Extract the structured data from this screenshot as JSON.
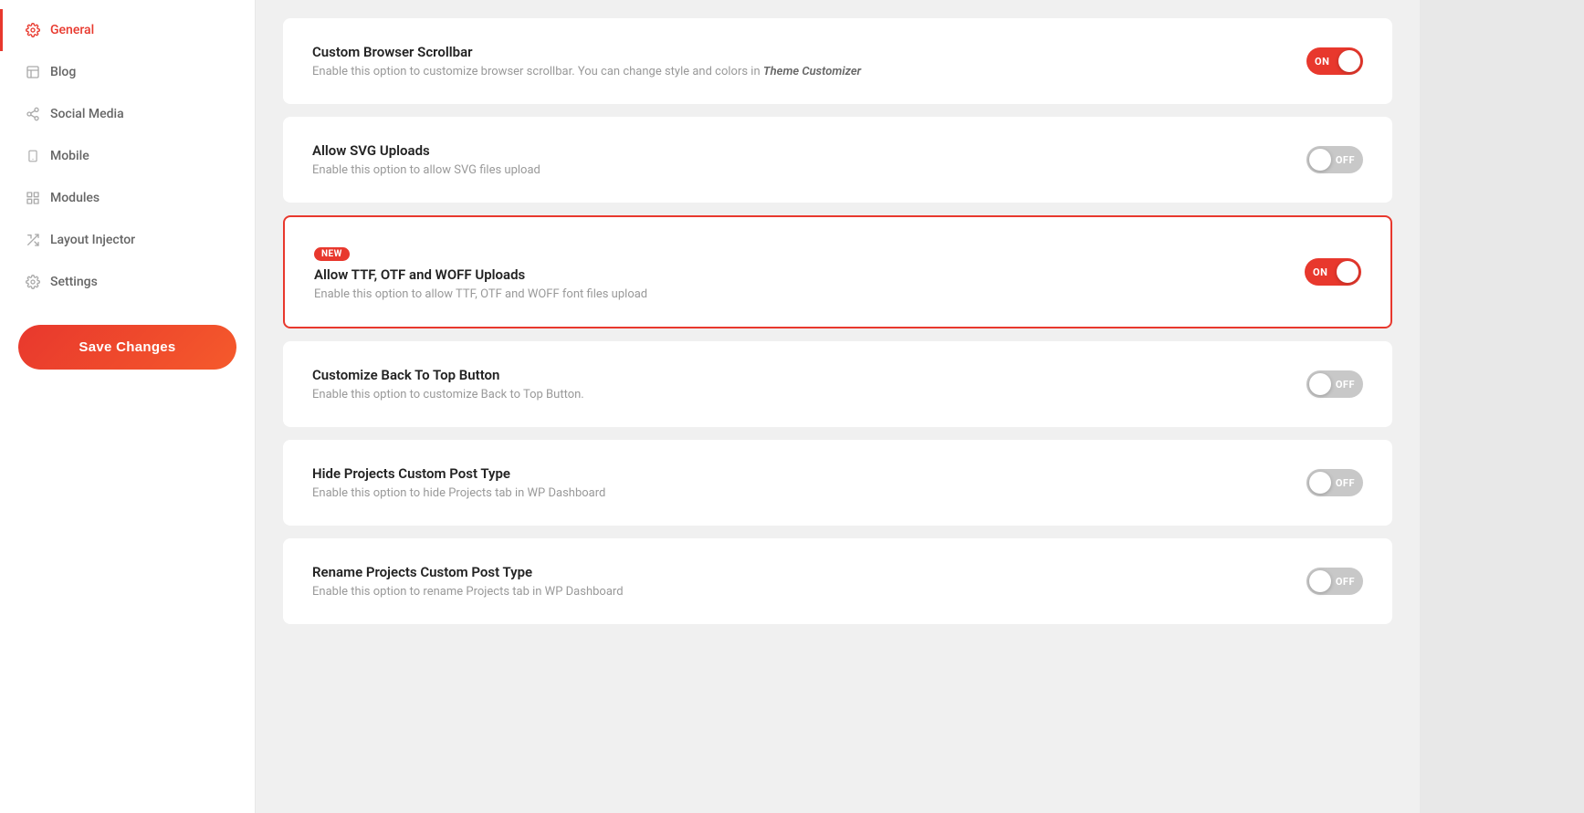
{
  "sidebar": {
    "items": [
      {
        "id": "general",
        "label": "General",
        "icon": "gear",
        "active": true
      },
      {
        "id": "blog",
        "label": "Blog",
        "icon": "blog"
      },
      {
        "id": "social-media",
        "label": "Social Media",
        "icon": "social"
      },
      {
        "id": "mobile",
        "label": "Mobile",
        "icon": "mobile"
      },
      {
        "id": "modules",
        "label": "Modules",
        "icon": "modules"
      },
      {
        "id": "layout-injector",
        "label": "Layout Injector",
        "icon": "layout"
      },
      {
        "id": "settings",
        "label": "Settings",
        "icon": "settings"
      }
    ],
    "save_button_label": "Save Changes"
  },
  "settings": [
    {
      "id": "custom-browser-scrollbar",
      "label": "Custom Browser Scrollbar",
      "desc": "Enable this option to customize browser scrollbar. You can change style and colors in ",
      "desc_link": "Theme Customizer",
      "state": "on",
      "new": false,
      "highlighted": false
    },
    {
      "id": "allow-svg-uploads",
      "label": "Allow SVG Uploads",
      "desc": "Enable this option to allow SVG files upload",
      "state": "off",
      "new": false,
      "highlighted": false
    },
    {
      "id": "allow-ttf-otf-woff",
      "label": "Allow TTF, OTF and WOFF Uploads",
      "desc": "Enable this option to allow TTF, OTF and WOFF font files upload",
      "state": "on",
      "new": true,
      "new_label": "NEW",
      "highlighted": true
    },
    {
      "id": "customize-back-to-top",
      "label": "Customize Back To Top Button",
      "desc": "Enable this option to customize Back to Top Button.",
      "state": "off",
      "new": false,
      "highlighted": false
    },
    {
      "id": "hide-projects-cpt",
      "label": "Hide Projects Custom Post Type",
      "desc": "Enable this option to hide Projects tab in WP Dashboard",
      "state": "off",
      "new": false,
      "highlighted": false
    },
    {
      "id": "rename-projects-cpt",
      "label": "Rename Projects Custom Post Type",
      "desc": "Enable this option to rename Projects tab in WP Dashboard",
      "state": "off",
      "new": false,
      "highlighted": false
    }
  ]
}
